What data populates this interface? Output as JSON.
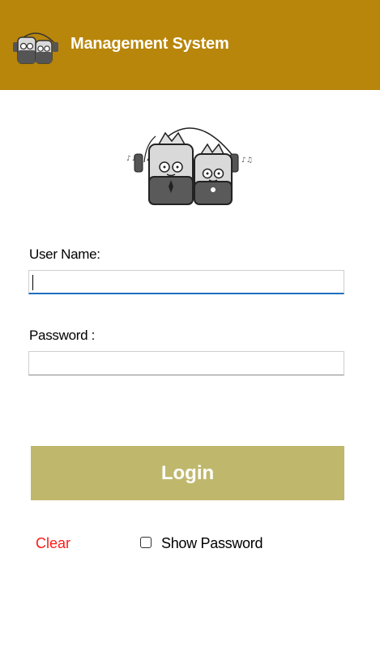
{
  "header": {
    "title": "Management System",
    "logo_icon": "two-robots-headphones-logo",
    "background_color": "#b8860b"
  },
  "main": {
    "logo_icon": "two-robots-headphones-logo"
  },
  "form": {
    "username_label": "User Name:",
    "username_value": "",
    "password_label": "Password :",
    "password_value": "",
    "login_label": "Login",
    "login_color": "#bfb86c",
    "clear_label": "Clear",
    "clear_color": "#ff1a1a",
    "show_password_label": "Show Password",
    "show_password_checked": false,
    "focus_color": "#1f6fbf"
  }
}
